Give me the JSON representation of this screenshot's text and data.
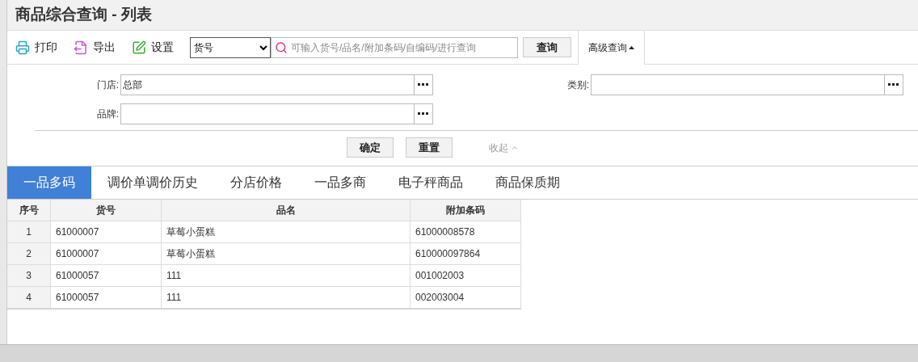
{
  "title": "商品综合查询 - 列表",
  "toolbar": [
    {
      "kind": "print",
      "label": "打印"
    },
    {
      "kind": "export",
      "label": "导出"
    },
    {
      "kind": "settings",
      "label": "设置"
    }
  ],
  "search": {
    "field": "货号",
    "placeholder": "可输入货号/品名/附加条码/自编码/进行查询",
    "button": "查询",
    "advanced": "高级查询",
    "advanced_expanded": true
  },
  "filters": [
    {
      "label": "门店:",
      "value": "总部"
    },
    {
      "label": "类别:"
    },
    {
      "label": "品牌:"
    }
  ],
  "form_buttons": [
    "确定",
    "重置"
  ],
  "collapse": "收起",
  "tabs": [
    {
      "label": "一品多码",
      "selected": true
    },
    {
      "label": "调价单调价历史",
      "selected": false
    },
    {
      "label": "分店价格",
      "selected": false
    },
    {
      "label": "一品多商",
      "selected": false
    },
    {
      "label": "电子秤商品",
      "selected": false
    },
    {
      "label": "商品保质期",
      "selected": false
    }
  ],
  "table": {
    "columns": [
      "序号",
      "货号",
      "品名",
      "附加条码"
    ],
    "rows": [
      [
        "1",
        "61000007",
        "草莓小蛋糕",
        "61000008578"
      ],
      [
        "2",
        "61000007",
        "草莓小蛋糕",
        "610000097864"
      ],
      [
        "3",
        "61000057",
        "111",
        "001002003"
      ],
      [
        "4",
        "61000057",
        "111",
        "002003004"
      ]
    ]
  }
}
